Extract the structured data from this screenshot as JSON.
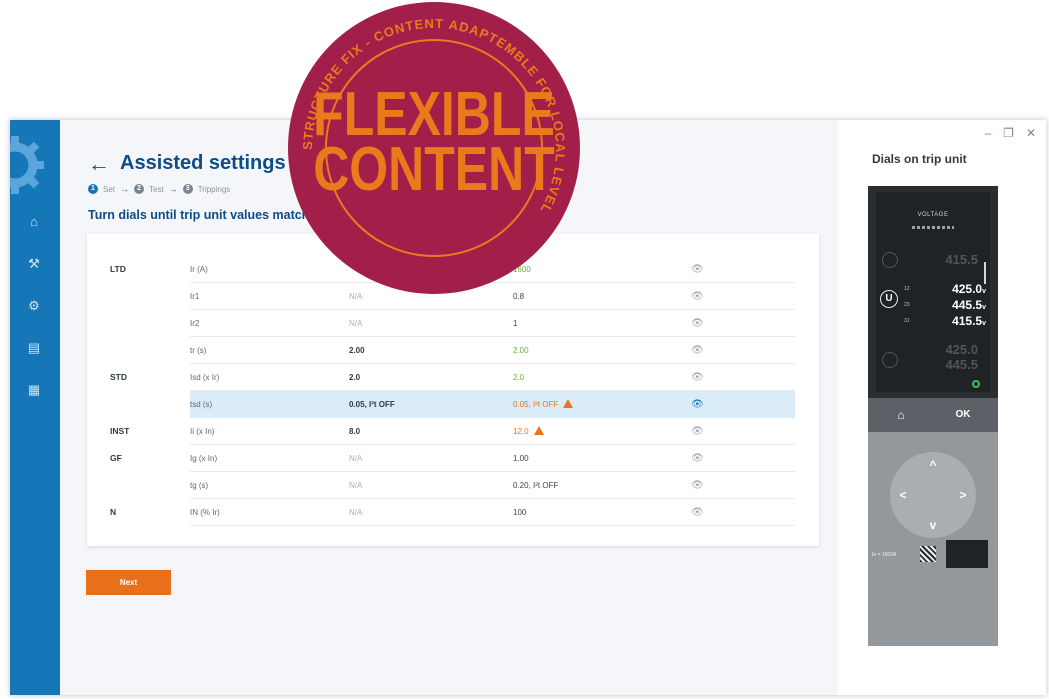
{
  "window": {
    "minimize": "–",
    "restore": "❐",
    "close": "✕"
  },
  "sidebar": {
    "items": [
      {
        "icon": "home-icon",
        "glyph": "⌂"
      },
      {
        "icon": "tools-icon",
        "glyph": "⚒"
      },
      {
        "icon": "settings-icon",
        "glyph": "⚙"
      },
      {
        "icon": "document-icon",
        "glyph": "▤"
      },
      {
        "icon": "report-icon",
        "glyph": "▦"
      }
    ]
  },
  "header": {
    "back": "←",
    "title": "Assisted settings",
    "steps": [
      {
        "num": "1",
        "label": "Set"
      },
      {
        "num": "2",
        "label": "Test"
      },
      {
        "num": "3",
        "label": "Trippings"
      }
    ],
    "instruction": "Turn dials until trip unit values matches t"
  },
  "table": {
    "rows": [
      {
        "group": "LTD",
        "param": "Ir (A)",
        "set": "",
        "trip": "1600",
        "trip_style": "green"
      },
      {
        "group": "",
        "param": "Ir1",
        "set": "N/A",
        "trip": "0.8"
      },
      {
        "group": "",
        "param": "Ir2",
        "set": "N/A",
        "trip": "1"
      },
      {
        "group": "",
        "param": "tr (s)",
        "set": "2.00",
        "trip": "2.00",
        "trip_style": "green"
      },
      {
        "group": "STD",
        "param": "Isd (x Ir)",
        "set": "2.0",
        "trip": "2.0",
        "trip_style": "green"
      },
      {
        "group": "",
        "param": "tsd (s)",
        "set": "0.05, I²t OFF",
        "trip": "0.05, I²t OFF",
        "trip_style": "orange",
        "warning": true,
        "highlight": true
      },
      {
        "group": "INST",
        "param": "Ii (x In)",
        "set": "8.0",
        "trip": "12.0",
        "trip_style": "orange",
        "warning": true
      },
      {
        "group": "GF",
        "param": "Ig (x In)",
        "set": "N/A",
        "trip": "1.00"
      },
      {
        "group": "",
        "param": "tg (s)",
        "set": "N/A",
        "trip": "0.20, I²t OFF"
      },
      {
        "group": "N",
        "param": "IN (% Ir)",
        "set": "N/A",
        "trip": "100"
      }
    ],
    "eye_glyph": "👁"
  },
  "actions": {
    "next_label": "Next"
  },
  "right_panel": {
    "title": "Dials on trip unit",
    "device": {
      "screen_label": "VOLTAGE",
      "ghost_top": "415.5",
      "phase_symbol": "U",
      "readings": [
        {
          "phase": "12",
          "value": "425.0",
          "unit": "v"
        },
        {
          "phase": "23",
          "value": "445.5",
          "unit": "v"
        },
        {
          "phase": "31",
          "value": "415.5",
          "unit": "v"
        }
      ],
      "ghost_bottom": "425.0",
      "ghost_bottom2": "445.5",
      "home_key": "⌂",
      "ok_key": "OK",
      "up": "^",
      "down": "v",
      "left": "<",
      "right": ">",
      "rating": "In = 1600A"
    }
  },
  "stamp": {
    "main_line1": "FLEXIBLE",
    "main_line2": "CONTENT",
    "ring_text": "STRUCTURE FIX - CONTENT ADAPTEMBLE FOR LOCAL LEVEL"
  },
  "colors": {
    "sidebar": "#1677b8",
    "title": "#0b4d8c",
    "accent_orange": "#e8701a",
    "ok_green": "#6cae3f",
    "stamp_red": "#a21f4a",
    "stamp_orange": "#ec7a1c"
  }
}
